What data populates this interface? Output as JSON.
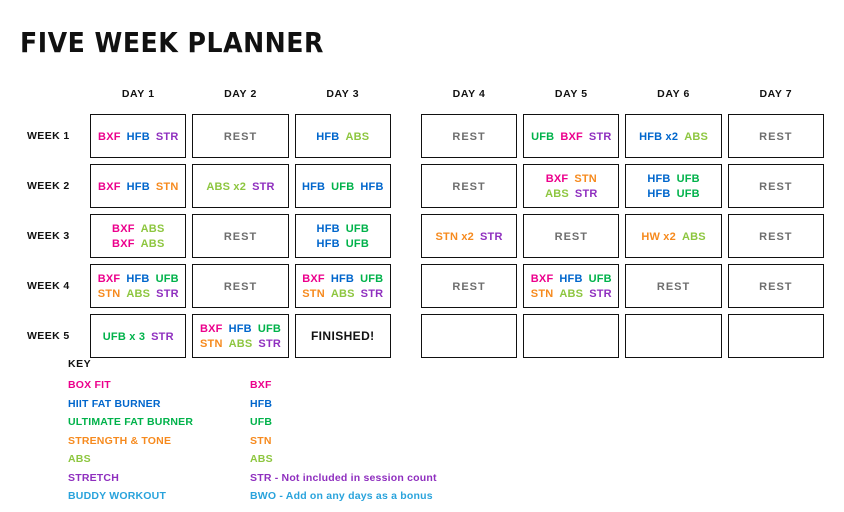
{
  "title": "FIVE WEEK PLANNER",
  "colors": {
    "boxfit": "#ec008c",
    "hiit": "#0066cc",
    "ultimate": "#00b24a",
    "strength": "#f68a1e",
    "abs": "#8dc63f",
    "stretch": "#8f2fbf",
    "buddy": "#29a3dc",
    "rest": "#6e6e6e",
    "ink": "#111111"
  },
  "day_headers": [
    "DAY 1",
    "DAY 2",
    "DAY 3",
    "DAY 4",
    "DAY 5",
    "DAY 6",
    "DAY 7"
  ],
  "week_labels": [
    "WEEK 1",
    "WEEK 2",
    "WEEK 3",
    "WEEK 4",
    "WEEK 5"
  ],
  "rows": [
    {
      "label": "WEEK 1",
      "cells": [
        {
          "type": "tokens",
          "lines": [
            [
              {
                "t": "BXF",
                "c": "boxfit"
              },
              {
                "t": "HFB",
                "c": "hiit"
              },
              {
                "t": "STR",
                "c": "stretch"
              }
            ]
          ]
        },
        {
          "type": "rest",
          "text": "REST"
        },
        {
          "type": "tokens",
          "lines": [
            [
              {
                "t": "HFB",
                "c": "hiit"
              },
              {
                "t": "ABS",
                "c": "abs"
              }
            ]
          ]
        },
        {
          "type": "rest",
          "text": "REST"
        },
        {
          "type": "tokens",
          "lines": [
            [
              {
                "t": "UFB",
                "c": "ultimate"
              },
              {
                "t": "BXF",
                "c": "boxfit"
              },
              {
                "t": "STR",
                "c": "stretch"
              }
            ]
          ]
        },
        {
          "type": "tokens",
          "lines": [
            [
              {
                "t": "HFB x2",
                "c": "hiit"
              },
              {
                "t": "ABS",
                "c": "abs"
              }
            ]
          ]
        },
        {
          "type": "rest",
          "text": "REST"
        }
      ]
    },
    {
      "label": "WEEK 2",
      "cells": [
        {
          "type": "tokens",
          "lines": [
            [
              {
                "t": "BXF",
                "c": "boxfit"
              },
              {
                "t": "HFB",
                "c": "hiit"
              },
              {
                "t": "STN",
                "c": "strength"
              }
            ]
          ]
        },
        {
          "type": "tokens",
          "lines": [
            [
              {
                "t": "ABS x2",
                "c": "abs"
              },
              {
                "t": "STR",
                "c": "stretch"
              }
            ]
          ]
        },
        {
          "type": "tokens",
          "lines": [
            [
              {
                "t": "HFB",
                "c": "hiit"
              },
              {
                "t": "UFB",
                "c": "ultimate"
              },
              {
                "t": "HFB",
                "c": "hiit"
              }
            ]
          ]
        },
        {
          "type": "rest",
          "text": "REST"
        },
        {
          "type": "tokens",
          "lines": [
            [
              {
                "t": "BXF",
                "c": "boxfit"
              },
              {
                "t": "STN",
                "c": "strength"
              }
            ],
            [
              {
                "t": "ABS",
                "c": "abs"
              },
              {
                "t": "STR",
                "c": "stretch"
              }
            ]
          ]
        },
        {
          "type": "tokens",
          "lines": [
            [
              {
                "t": "HFB",
                "c": "hiit"
              },
              {
                "t": "UFB",
                "c": "ultimate"
              }
            ],
            [
              {
                "t": "HFB",
                "c": "hiit"
              },
              {
                "t": "UFB",
                "c": "ultimate"
              }
            ]
          ]
        },
        {
          "type": "rest",
          "text": "REST"
        }
      ]
    },
    {
      "label": "WEEK 3",
      "cells": [
        {
          "type": "tokens",
          "lines": [
            [
              {
                "t": "BXF",
                "c": "boxfit"
              },
              {
                "t": "ABS",
                "c": "abs"
              }
            ],
            [
              {
                "t": "BXF",
                "c": "boxfit"
              },
              {
                "t": "ABS",
                "c": "abs"
              }
            ]
          ]
        },
        {
          "type": "rest",
          "text": "REST"
        },
        {
          "type": "tokens",
          "lines": [
            [
              {
                "t": "HFB",
                "c": "hiit"
              },
              {
                "t": "UFB",
                "c": "ultimate"
              }
            ],
            [
              {
                "t": "HFB",
                "c": "hiit"
              },
              {
                "t": "UFB",
                "c": "ultimate"
              }
            ]
          ]
        },
        {
          "type": "tokens",
          "lines": [
            [
              {
                "t": "STN x2",
                "c": "strength"
              },
              {
                "t": "STR",
                "c": "stretch"
              }
            ]
          ]
        },
        {
          "type": "rest",
          "text": "REST"
        },
        {
          "type": "tokens",
          "lines": [
            [
              {
                "t": "HW x2",
                "c": "strength"
              },
              {
                "t": "ABS",
                "c": "abs"
              }
            ]
          ]
        },
        {
          "type": "rest",
          "text": "REST"
        }
      ]
    },
    {
      "label": "WEEK 4",
      "cells": [
        {
          "type": "tokens",
          "lines": [
            [
              {
                "t": "BXF",
                "c": "boxfit"
              },
              {
                "t": "HFB",
                "c": "hiit"
              },
              {
                "t": "UFB",
                "c": "ultimate"
              }
            ],
            [
              {
                "t": "STN",
                "c": "strength"
              },
              {
                "t": "ABS",
                "c": "abs"
              },
              {
                "t": "STR",
                "c": "stretch"
              }
            ]
          ]
        },
        {
          "type": "rest",
          "text": "REST"
        },
        {
          "type": "tokens",
          "lines": [
            [
              {
                "t": "BXF",
                "c": "boxfit"
              },
              {
                "t": "HFB",
                "c": "hiit"
              },
              {
                "t": "UFB",
                "c": "ultimate"
              }
            ],
            [
              {
                "t": "STN",
                "c": "strength"
              },
              {
                "t": "ABS",
                "c": "abs"
              },
              {
                "t": "STR",
                "c": "stretch"
              }
            ]
          ]
        },
        {
          "type": "rest",
          "text": "REST"
        },
        {
          "type": "tokens",
          "lines": [
            [
              {
                "t": "BXF",
                "c": "boxfit"
              },
              {
                "t": "HFB",
                "c": "hiit"
              },
              {
                "t": "UFB",
                "c": "ultimate"
              }
            ],
            [
              {
                "t": "STN",
                "c": "strength"
              },
              {
                "t": "ABS",
                "c": "abs"
              },
              {
                "t": "STR",
                "c": "stretch"
              }
            ]
          ]
        },
        {
          "type": "rest",
          "text": "REST"
        },
        {
          "type": "rest",
          "text": "REST"
        }
      ]
    },
    {
      "label": "WEEK 5",
      "cells": [
        {
          "type": "tokens",
          "lines": [
            [
              {
                "t": "UFB x 3",
                "c": "ultimate"
              },
              {
                "t": "STR",
                "c": "stretch"
              }
            ]
          ]
        },
        {
          "type": "tokens",
          "lines": [
            [
              {
                "t": "BXF",
                "c": "boxfit"
              },
              {
                "t": "HFB",
                "c": "hiit"
              },
              {
                "t": "UFB",
                "c": "ultimate"
              }
            ],
            [
              {
                "t": "STN",
                "c": "strength"
              },
              {
                "t": "ABS",
                "c": "abs"
              },
              {
                "t": "STR",
                "c": "stretch"
              }
            ]
          ]
        },
        {
          "type": "finished",
          "text": "FINISHED!"
        },
        {
          "type": "empty"
        },
        {
          "type": "empty"
        },
        {
          "type": "empty"
        },
        {
          "type": "empty"
        }
      ]
    }
  ],
  "key": {
    "heading": "KEY",
    "items": [
      {
        "name": "BOX FIT",
        "abbr": "BXF",
        "c": "boxfit"
      },
      {
        "name": "HIIT FAT BURNER",
        "abbr": "HFB",
        "c": "hiit"
      },
      {
        "name": "ULTIMATE FAT BURNER",
        "abbr": "UFB",
        "c": "ultimate"
      },
      {
        "name": "STRENGTH & TONE",
        "abbr": "STN",
        "c": "strength"
      },
      {
        "name": "ABS",
        "abbr": "ABS",
        "c": "abs"
      },
      {
        "name": "STRETCH",
        "abbr": "STR - Not included in session count",
        "c": "stretch"
      },
      {
        "name": "BUDDY WORKOUT",
        "abbr": "BWO - Add on any days as a bonus",
        "c": "buddy"
      }
    ]
  }
}
